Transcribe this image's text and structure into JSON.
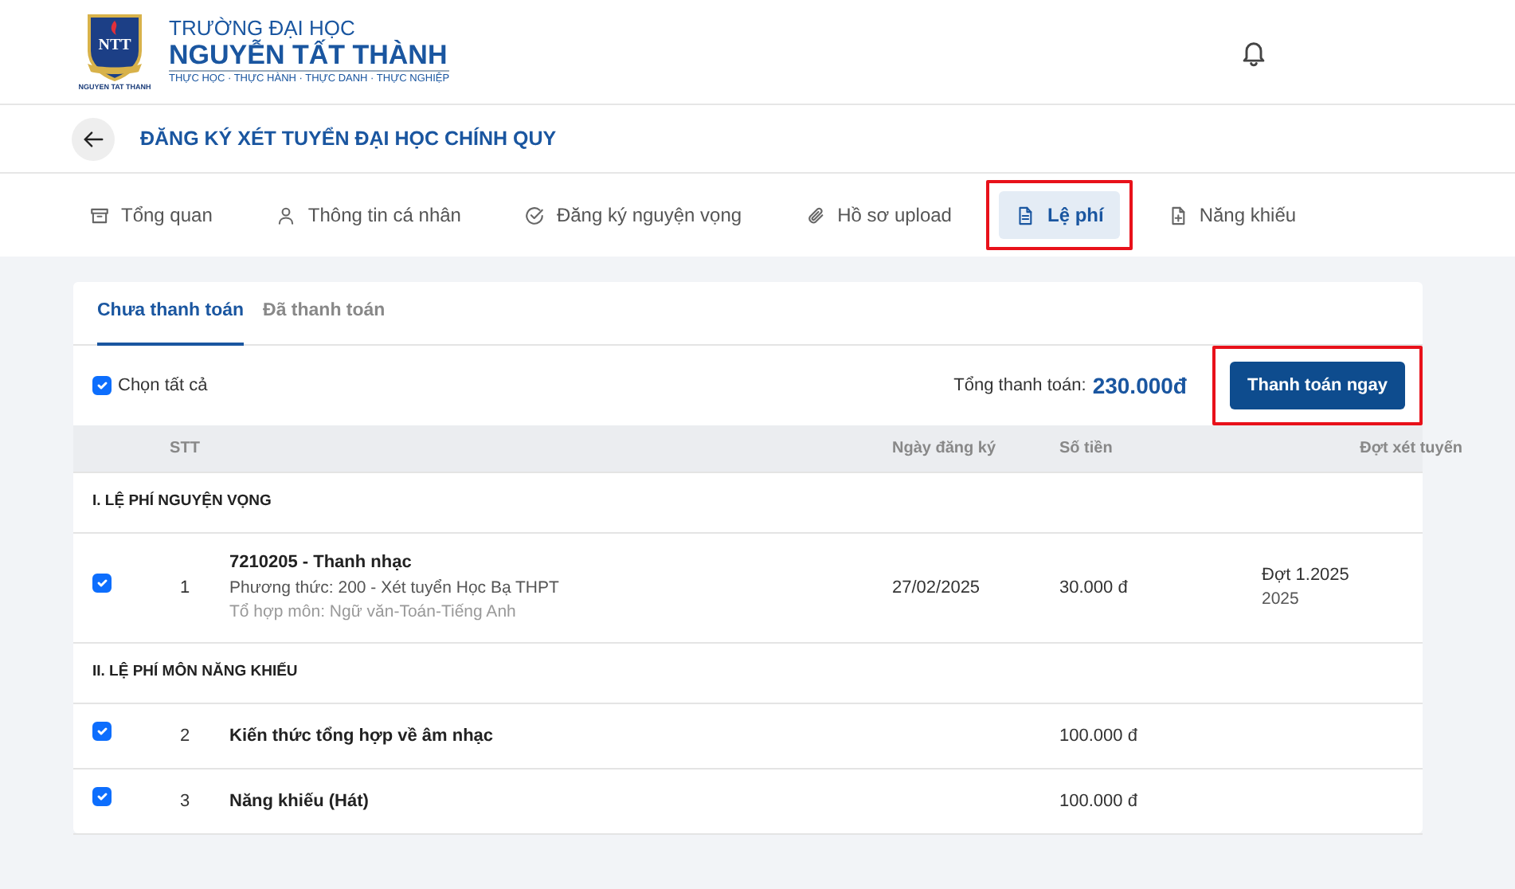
{
  "header": {
    "logo_letters": "NTT",
    "logo_caption": "NGUYEN TAT THANH",
    "school_line1": "TRƯỜNG ĐẠI HỌC",
    "school_line2": "NGUYỄN TẤT THÀNH",
    "motto": "THỰC HỌC · THỰC HÀNH · THỰC DANH · THỰC NGHIỆP"
  },
  "page_title": "ĐĂNG KÝ XÉT TUYỂN ĐẠI HỌC CHÍNH QUY",
  "tabs": [
    {
      "label": "Tổng quan",
      "selected": false,
      "highlighted": false
    },
    {
      "label": "Thông tin cá nhân",
      "selected": false,
      "highlighted": false
    },
    {
      "label": "Đăng ký nguyện vọng",
      "selected": false,
      "highlighted": false
    },
    {
      "label": "Hồ sơ upload",
      "selected": false,
      "highlighted": false
    },
    {
      "label": "Lệ phí",
      "selected": true,
      "highlighted": true
    },
    {
      "label": "Năng khiếu",
      "selected": false,
      "highlighted": false
    }
  ],
  "subtabs": [
    {
      "label": "Chưa thanh toán",
      "selected": true
    },
    {
      "label": "Đã thanh toán",
      "selected": false
    }
  ],
  "select_all": {
    "label": "Chọn tất cả",
    "checked": true
  },
  "total": {
    "label": "Tổng thanh toán:",
    "amount": "230.000đ"
  },
  "pay_button": {
    "label": "Thanh toán ngay",
    "highlighted": true
  },
  "table": {
    "columns": [
      "STT",
      "Ngày đăng ký",
      "Số tiền",
      "Đợt xét tuyến"
    ],
    "rows": [
      {
        "kind": "group",
        "title": "I. LỆ PHÍ NGUYỆN VỌNG"
      },
      {
        "kind": "item",
        "checked": true,
        "stt": "1",
        "title": "7210205 - Thanh nhạc",
        "lines": [
          "Phương thức: 200 - Xét tuyển Học Bạ THPT",
          "Tổ hợp môn: Ngữ văn-Toán-Tiếng Anh"
        ],
        "date": "27/02/2025",
        "amount": "30.000 đ",
        "round": "Đợt 1.2025",
        "round_year": "2025"
      },
      {
        "kind": "group",
        "title": "II. LỆ PHÍ MÔN NĂNG KHIẾU"
      },
      {
        "kind": "item",
        "checked": true,
        "stt": "2",
        "title": "Kiến thức tổng hợp về âm nhạc",
        "amount": "100.000 đ"
      },
      {
        "kind": "item",
        "checked": true,
        "stt": "3",
        "title": "Năng khiếu (Hát)",
        "amount": "100.000 đ"
      }
    ]
  }
}
